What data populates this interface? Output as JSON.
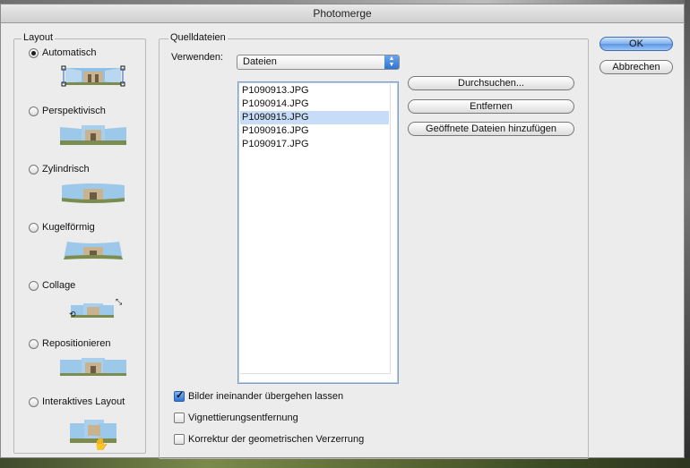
{
  "window": {
    "title": "Photomerge"
  },
  "layout": {
    "legend": "Layout",
    "options": [
      {
        "label": "Automatisch",
        "checked": true
      },
      {
        "label": "Perspektivisch",
        "checked": false
      },
      {
        "label": "Zylindrisch",
        "checked": false
      },
      {
        "label": "Kugelförmig",
        "checked": false
      },
      {
        "label": "Collage",
        "checked": false
      },
      {
        "label": "Repositionieren",
        "checked": false
      },
      {
        "label": "Interaktives Layout",
        "checked": false
      }
    ]
  },
  "source": {
    "legend": "Quelldateien",
    "use_label": "Verwenden:",
    "use_value": "Dateien",
    "files": [
      "P1090913.JPG",
      "P1090914.JPG",
      "P1090915.JPG",
      "P1090916.JPG",
      "P1090917.JPG"
    ],
    "selected_file": "P1090915.JPG",
    "buttons": {
      "browse": "Durchsuchen...",
      "remove": "Entfernen",
      "add_open": "Geöffnete Dateien hinzufügen"
    },
    "options": [
      {
        "label": "Bilder ineinander übergehen lassen",
        "checked": true
      },
      {
        "label": "Vignettierungsentfernung",
        "checked": false
      },
      {
        "label": "Korrektur der geometrischen Verzerrung",
        "checked": false
      }
    ]
  },
  "actions": {
    "ok": "OK",
    "cancel": "Abbrechen"
  },
  "colors": {
    "accent": "#5b95e3",
    "selection": "#c7dcf6",
    "dialog_bg": "#ececec"
  }
}
